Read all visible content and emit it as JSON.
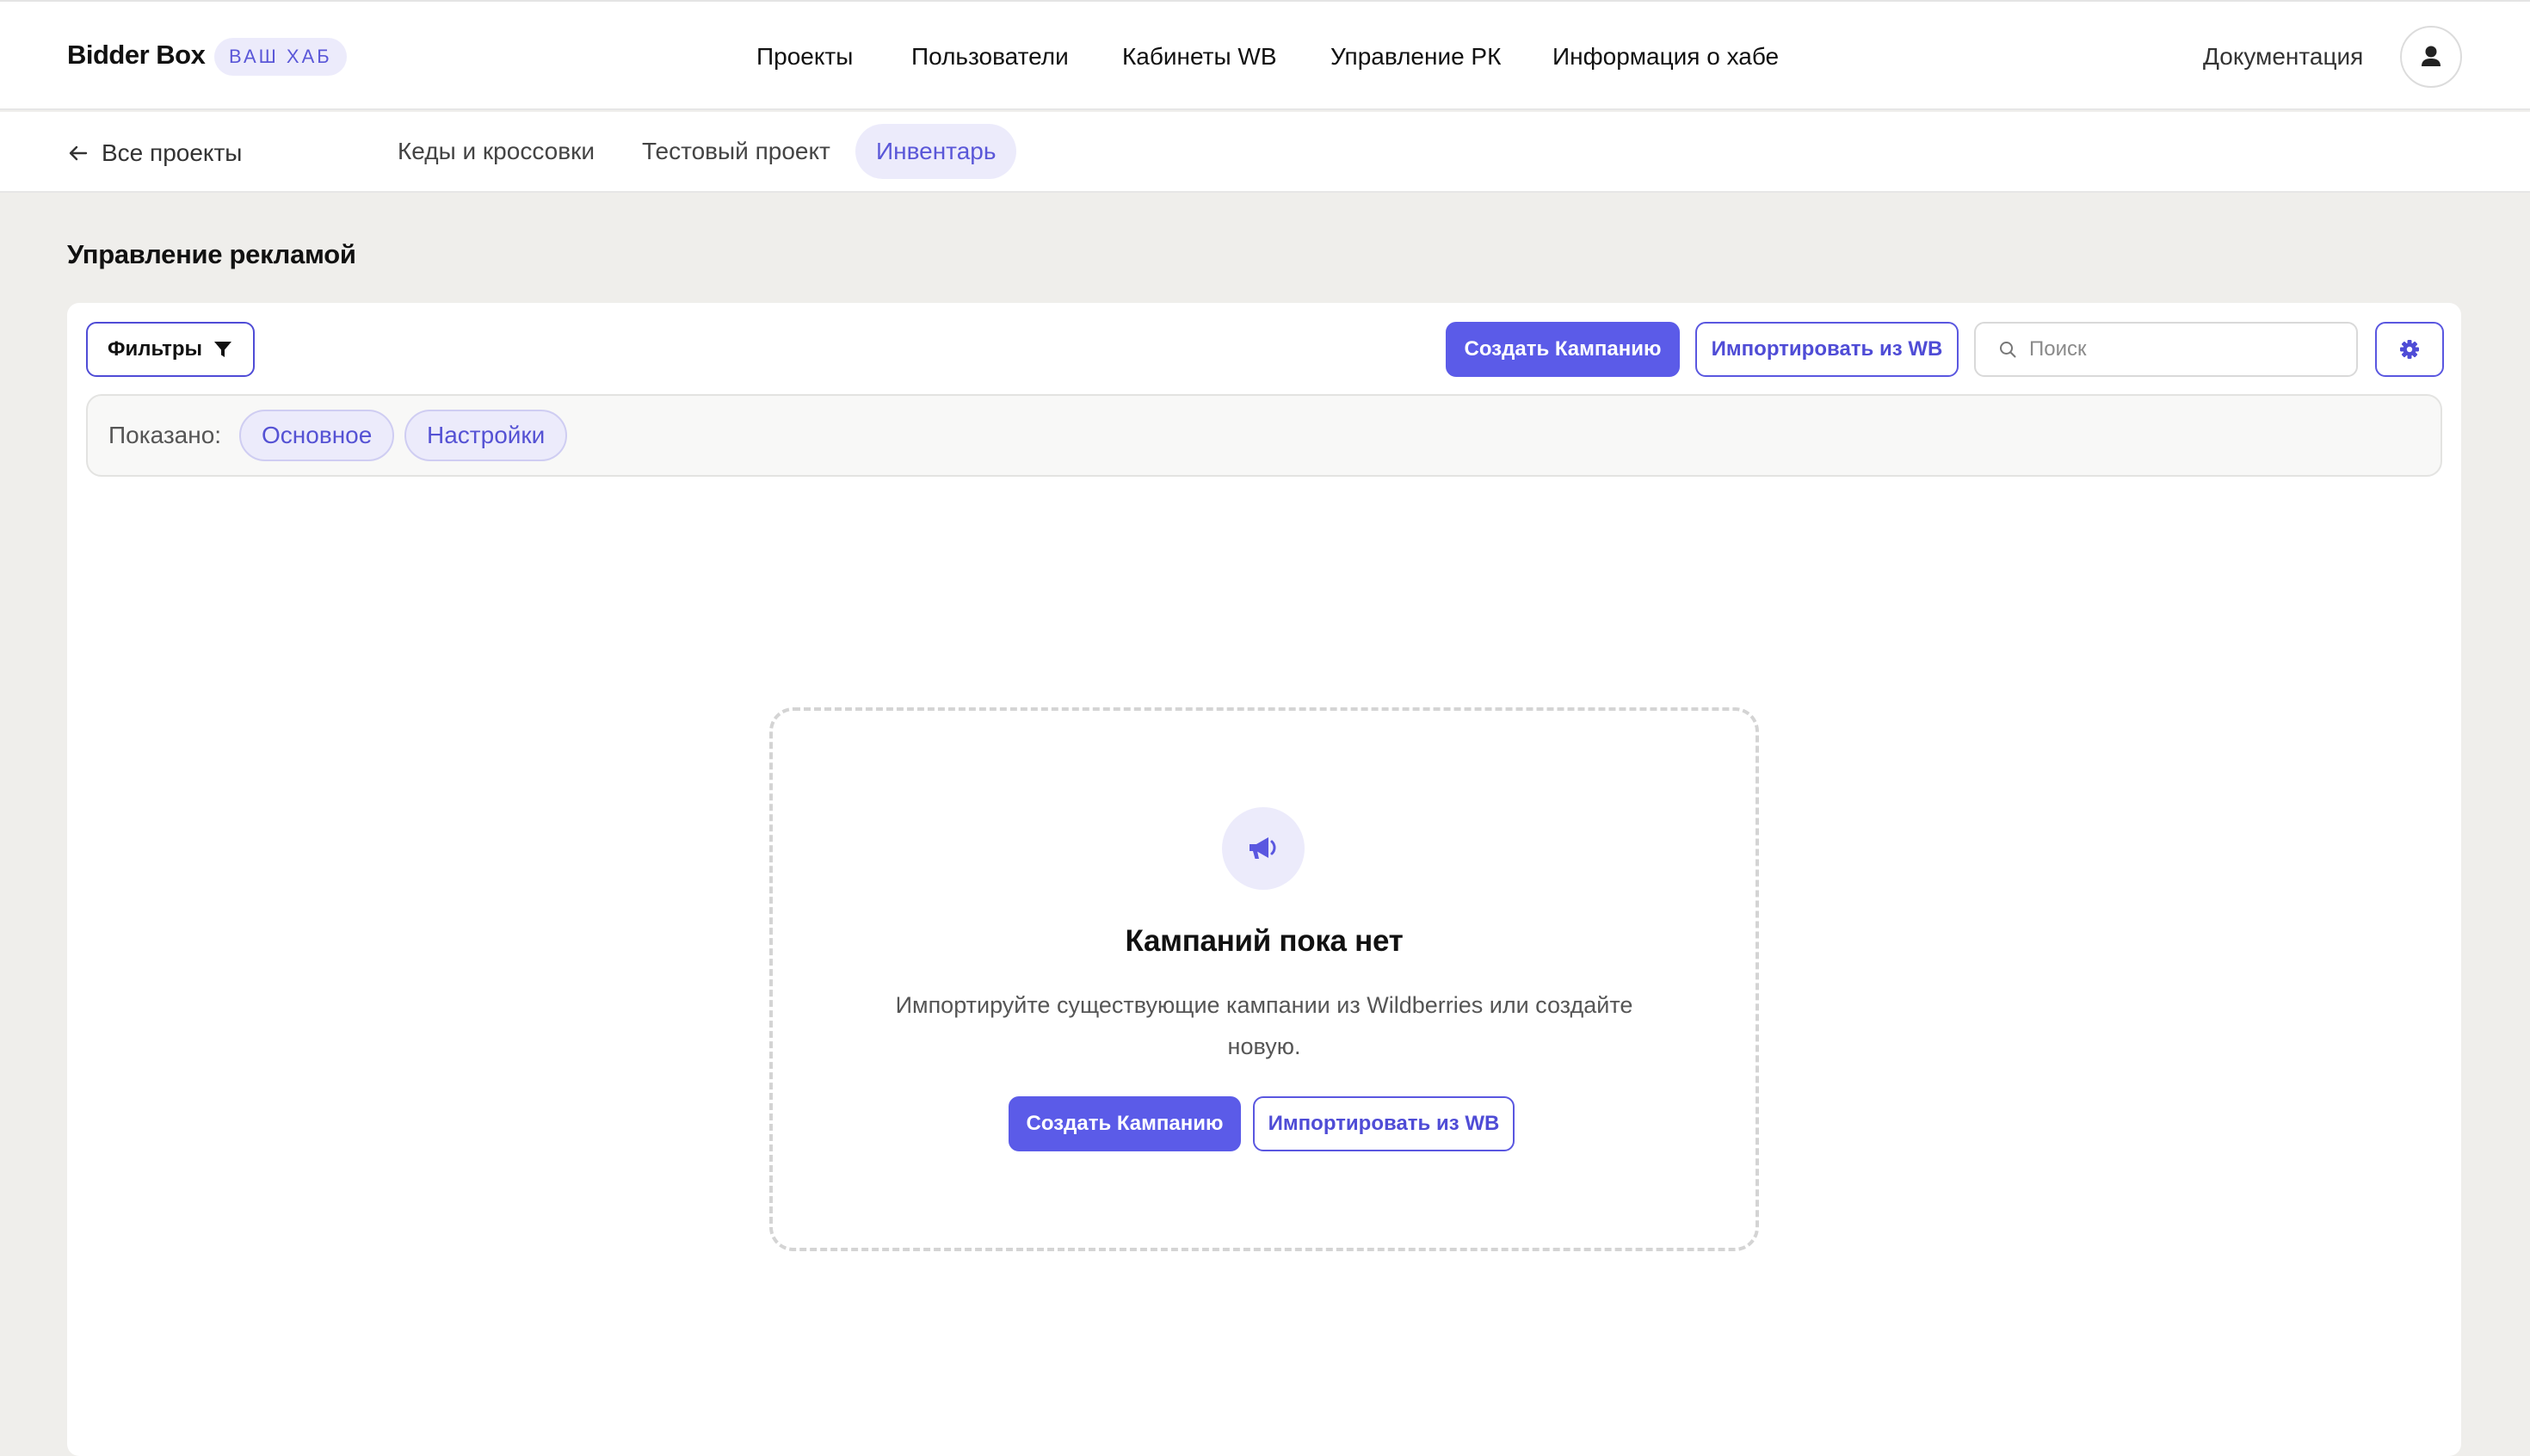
{
  "header": {
    "brand": "Bidder Box",
    "hub_badge": "ВАШ ХАБ",
    "nav": [
      "Проекты",
      "Пользователи",
      "Кабинеты WB",
      "Управление РК",
      "Информация о хабе"
    ],
    "docs": "Документация"
  },
  "subnav": {
    "back": "Все проекты",
    "projects": [
      "Кеды и кроссовки",
      "Тестовый проект",
      "Инвентарь"
    ],
    "active_project": "Инвентарь"
  },
  "page": {
    "title": "Управление рекламой"
  },
  "toolbar": {
    "filters": "Фильтры",
    "create": "Создать Кампанию",
    "import": "Импортировать из WB",
    "search_placeholder": "Поиск"
  },
  "shown": {
    "label": "Показано:",
    "chips": [
      "Основное",
      "Настройки"
    ]
  },
  "empty_state": {
    "icon": "megaphone-icon",
    "title": "Кампаний пока нет",
    "description": "Импортируйте существующие кампании из Wildberries или создайте новую.",
    "create": "Создать Кампанию",
    "import": "Импортировать из WB"
  },
  "colors": {
    "accent": "#5b5be8",
    "accent_soft": "#ecebfb",
    "page_bg": "#efeeeb"
  }
}
